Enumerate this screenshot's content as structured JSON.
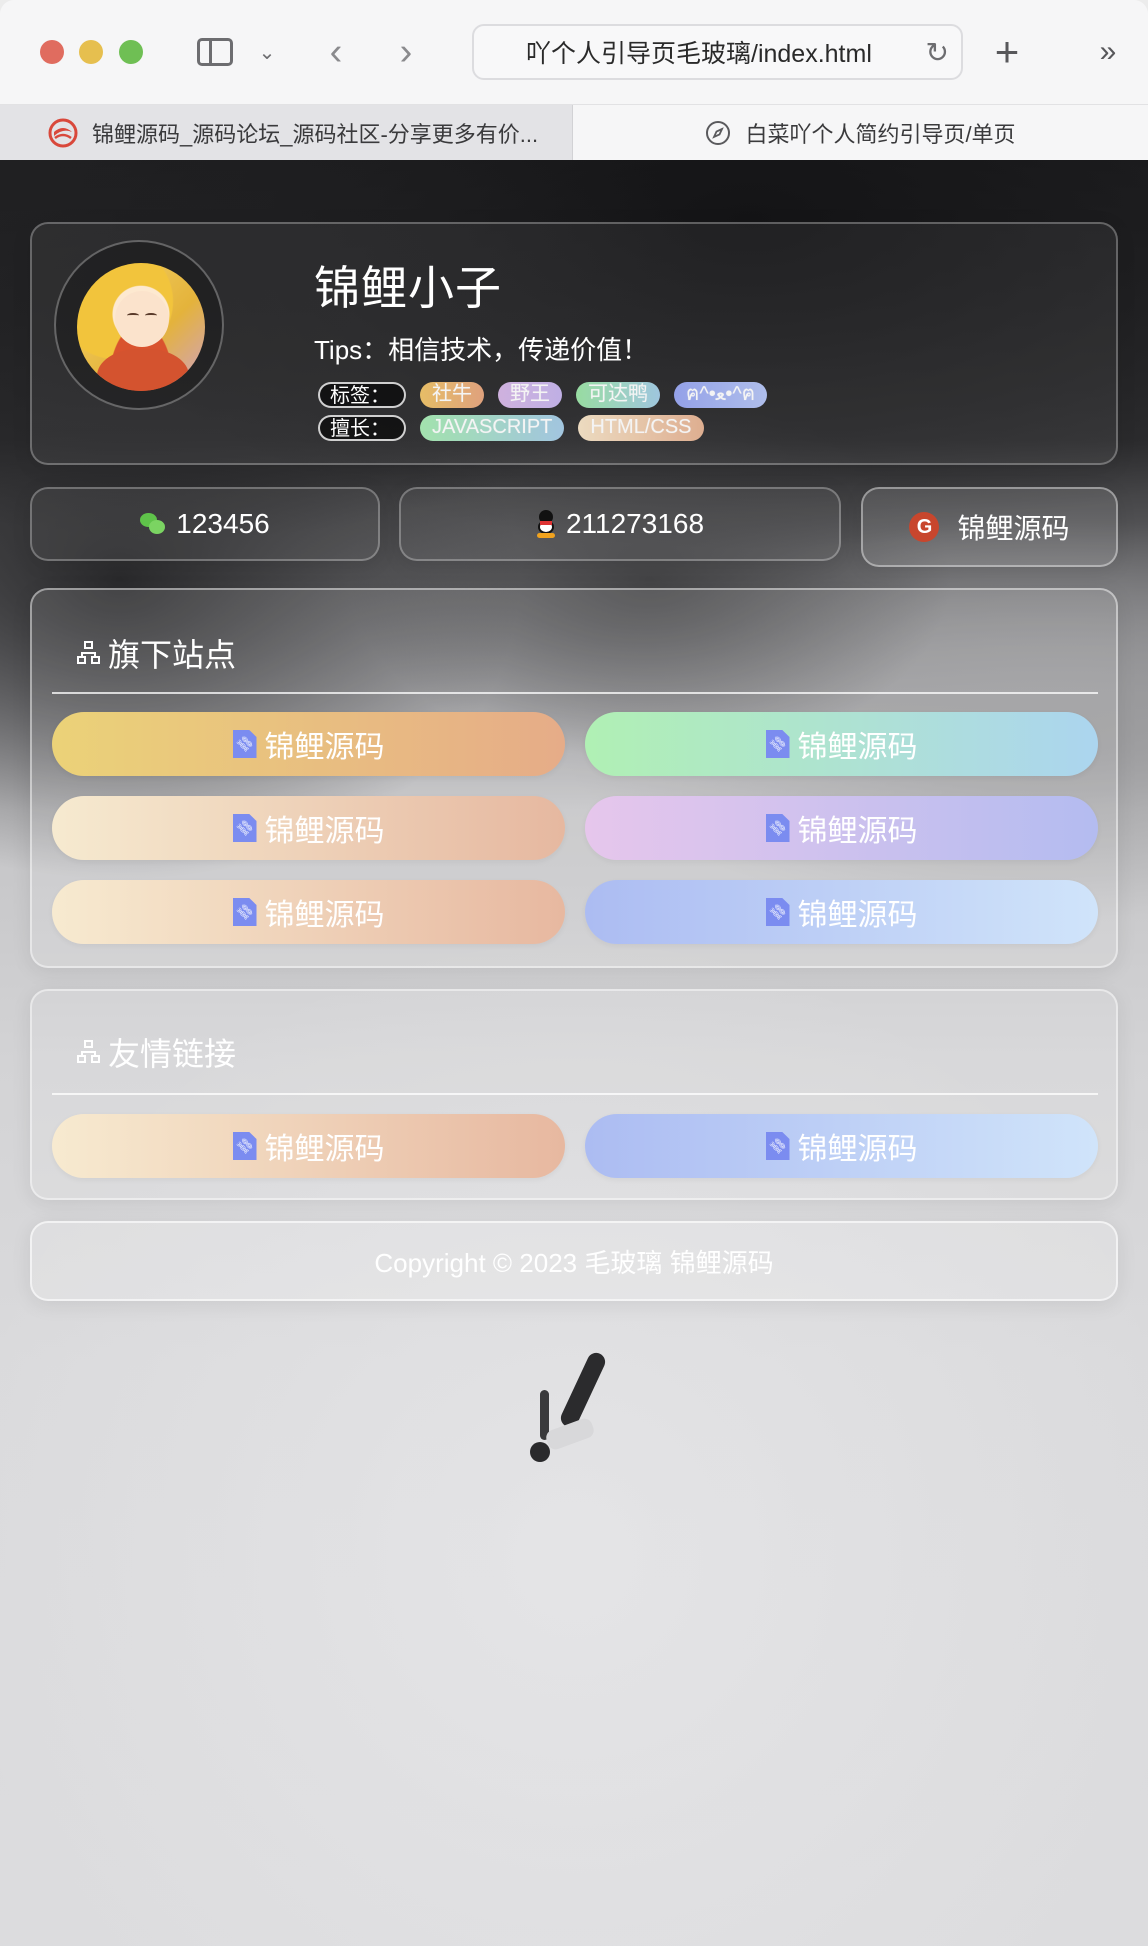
{
  "browser": {
    "url_text": "吖个人引导页毛玻璃/index.html",
    "tabs": [
      {
        "title": "锦鲤源码_源码论坛_源码社区-分享更多有价...",
        "icon": "site-favicon",
        "active": false
      },
      {
        "title": "白菜吖个人简约引导页/单页",
        "icon": "compass-icon",
        "active": true
      }
    ],
    "buttons": {
      "sidebar": "sidebar-icon",
      "chevron": "⌄",
      "back": "‹",
      "forward": "›",
      "reload": "↻",
      "new_tab": "+",
      "more": "»"
    }
  },
  "profile": {
    "name": "锦鲤小子",
    "tips": "Tips：相信技术，传递价值！",
    "tags_label": "标签：",
    "tags": [
      {
        "text": "社牛",
        "colors": [
          "#f0c56a",
          "#e9a882"
        ]
      },
      {
        "text": "野王",
        "colors": [
          "#d8b9e8",
          "#c7b6ee"
        ]
      },
      {
        "text": "可达鸭",
        "colors": [
          "#9ee6a8",
          "#a6cfe8"
        ]
      },
      {
        "text": "ฅ^•ﻌ•^ฅ",
        "colors": [
          "#9aa8f2",
          "#b6c6f6"
        ]
      }
    ],
    "skills_label": "擅长：",
    "skills": [
      {
        "text": "JAVASCRIPT",
        "colors": [
          "#a9ecb4",
          "#a8cde9"
        ]
      },
      {
        "text": "HTML/CSS",
        "colors": [
          "#f6e4c8",
          "#e8b596"
        ]
      }
    ]
  },
  "contacts": [
    {
      "icon": "wechat-icon",
      "value": "123456"
    },
    {
      "icon": "qq-icon",
      "value": "211273168"
    },
    {
      "icon": "gitee-icon",
      "value": "锦鲤源码",
      "icon_text": "G"
    }
  ],
  "sites": {
    "title": "旗下站点",
    "links": [
      {
        "label": "锦鲤源码",
        "colors": [
          "#ebd278",
          "#e6ac88"
        ]
      },
      {
        "label": "锦鲤源码",
        "colors": [
          "#b0f0b4",
          "#acd5ef"
        ]
      },
      {
        "label": "锦鲤源码",
        "colors": [
          "#f6ead0",
          "#e6b8a0"
        ]
      },
      {
        "label": "锦鲤源码",
        "colors": [
          "#e6c6ec",
          "#b4bcf0"
        ]
      },
      {
        "label": "锦鲤源码",
        "colors": [
          "#f7ead0",
          "#e7b8a0"
        ]
      },
      {
        "label": "锦鲤源码",
        "colors": [
          "#acbcf2",
          "#d0e4fa"
        ]
      }
    ]
  },
  "friends": {
    "title": "友情链接",
    "links": [
      {
        "label": "锦鲤源码",
        "colors": [
          "#f7ead0",
          "#e7b8a0"
        ]
      },
      {
        "label": "锦鲤源码",
        "colors": [
          "#acbcf2",
          "#d0e4fa"
        ]
      }
    ]
  },
  "footer": {
    "copyright": "Copyright © 2023 毛玻璃 锦鲤源码"
  }
}
